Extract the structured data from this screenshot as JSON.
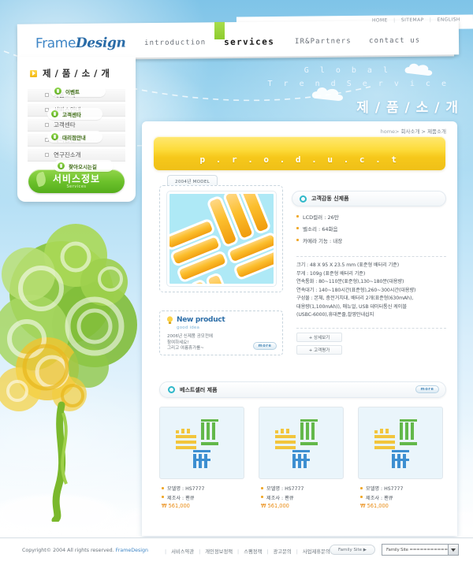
{
  "site": {
    "logo_frame": "Frame",
    "logo_design": "Design",
    "utility": [
      {
        "label": "HOME"
      },
      {
        "label": "SITEMAP"
      },
      {
        "label": "ENGLISH"
      }
    ],
    "nav": [
      {
        "label": "introduction"
      },
      {
        "label": "services"
      },
      {
        "label": "IR&Partners"
      },
      {
        "label": "contact us"
      }
    ]
  },
  "deco": {
    "line1": "G l o b a l",
    "line2": "T r e n d   S e r v i c e",
    "title": "제 / 품 / 소 / 개"
  },
  "sidebar": {
    "title": "제 / 품 / 소 / 개",
    "items": [
      {
        "label": "제품소개"
      },
      {
        "label": "서비스안내"
      },
      {
        "label": "고객센타"
      },
      {
        "label": "대리점안내"
      },
      {
        "label": "연구진소개"
      }
    ],
    "service_button": {
      "ko": "서비스정보",
      "en": "Services"
    }
  },
  "tree_links": [
    {
      "label": "이벤트"
    },
    {
      "label": "고객센타"
    },
    {
      "label": "대리점안내"
    },
    {
      "label": "찾아오시는길"
    }
  ],
  "main": {
    "breadcrumb_home": "home>",
    "breadcrumb_rest": " 회사소개 > 제품소개",
    "banner_text": "p . r . o . d . u . c . t",
    "product_tab": "2004년 MODEL",
    "product_heading": "고객감동 신제품",
    "spec_bullets": [
      "LCD컬러 :  26만",
      "벨소리 :  64화음",
      "카메라 기능 :  내장"
    ],
    "detail_lines": [
      "크기 : 48 X 95 X 23.5 mm (표준형 배터리 기준)",
      "무게 : 109g (표준형 배터리 기준)",
      "연속통화 : 80~110분(표준형),130~180분(대용량)",
      "연속대기 : 140~180시간(표준형),260~300시간(대용량)",
      "구성물 : 본체, 충전거치대, 배터리 2개(표준형(630mAh),",
      "대용량(1,100mAh)), 매뉴얼, USB 데이터통신 케이블",
      "(USBC-6000),휴대폰줄,촬영안내삽지"
    ],
    "mini_buttons": [
      {
        "label": "+ 상세보기"
      },
      {
        "label": "+ 고객평가"
      }
    ],
    "new_product": {
      "title": "New product",
      "subtitle": "good idea",
      "body": [
        "2006년 신제품 공모전에",
        "참여하세요!",
        "그리고 여름휴가를~"
      ],
      "more": "more"
    },
    "bestseller": {
      "title": "베스트셀러 제품",
      "more": "more"
    },
    "cards": [
      {
        "model_label": "모델명 :  HS7777",
        "maker_label": "제조사 :  팬큐",
        "price": "₩ 561,000"
      },
      {
        "model_label": "모델명 :  HS7777",
        "maker_label": "제조사 :  팬큐",
        "price": "₩ 561,000"
      },
      {
        "model_label": "모델명 :  HS7777",
        "maker_label": "제조사 :  팬큐",
        "price": "₩ 561,000"
      }
    ]
  },
  "footer": {
    "copyright_pre": "Copyright© 2004 All rights reserved. ",
    "copyright_brand": "FrameDesign",
    "links": [
      {
        "label": "서비스약관"
      },
      {
        "label": "개인정보정책"
      },
      {
        "label": "스팸정책"
      },
      {
        "label": "광고문의"
      },
      {
        "label": "사업제휴문의"
      }
    ],
    "family_button": "Family Site ▶",
    "family_select_value": "Family Site ================"
  },
  "colors": {
    "accent_yellow": "#f6c81a",
    "accent_green": "#6cc12b",
    "brand_blue": "#3f86c6",
    "price_orange": "#e98a10",
    "sky_blue": "#9ed5ef"
  }
}
